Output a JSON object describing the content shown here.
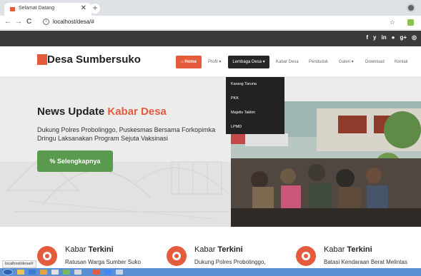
{
  "browser": {
    "tab_title": "Selamat Datang",
    "tab_close": "✕",
    "new_tab": "+",
    "url": "localhost/desa/#",
    "status_url": "localhost/desa/#",
    "nav": {
      "back": "←",
      "forward": "→",
      "reload": "C",
      "info": "i",
      "star": "☆"
    }
  },
  "topbar": {
    "social": [
      "f",
      "y",
      "in",
      "●",
      "g+",
      "◎"
    ]
  },
  "header": {
    "site_name": "Desa Sumbersuko",
    "menu": [
      {
        "label": "Home",
        "icon": "home-icon"
      },
      {
        "label": "Profil ▾"
      },
      {
        "label": "Lembaga Desa ▾"
      },
      {
        "label": "Kabar Desa"
      },
      {
        "label": "Penduduk"
      },
      {
        "label": "Galeri ▾"
      },
      {
        "label": "Download"
      },
      {
        "label": "Kontak"
      }
    ],
    "home_glyph": "⌂"
  },
  "dropdown": {
    "items": [
      "Karang Taruna",
      "PKK",
      "Majelis Taklim",
      "LPMD"
    ]
  },
  "hero": {
    "title_prefix": "News Update ",
    "title_accent": "Kabar Desa",
    "subtitle": "Dukung Polres Probolinggo, Puskesmas Bersama Forkopimka Dringu Laksanakan Program Sejuta Vaksinasi",
    "button_label": "Selengkapnya",
    "button_glyph": "%"
  },
  "kabar": [
    {
      "head_light": "Kabar ",
      "head_bold": "Terkini",
      "text": "Ratusan Warga Sumber Suko"
    },
    {
      "head_light": "Kabar ",
      "head_bold": "Terkini",
      "text": "Dukung Polres Probolinggo,"
    },
    {
      "head_light": "Kabar ",
      "head_bold": "Terkini",
      "text": "Batasi Kendaraan Berat Melintas"
    }
  ],
  "colors": {
    "accent": "#e55b3e",
    "topbar": "#3b3b3b",
    "button_green": "#5a9a4f",
    "dropdown_bg": "#222222"
  }
}
